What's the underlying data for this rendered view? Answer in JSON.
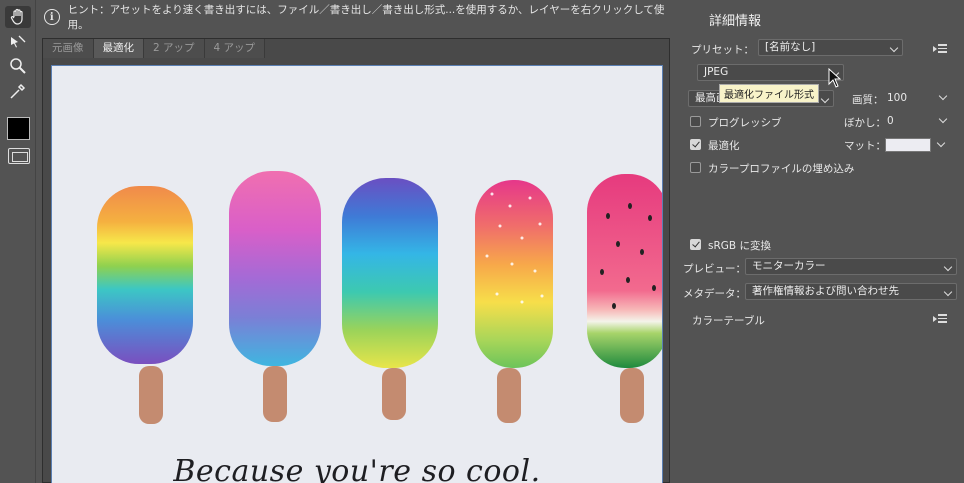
{
  "hint": {
    "text": "ヒント：アセットをより速く書き出すには、ファイル／書き出し／書き出し形式...を使用するか、レイヤーを右クリックして使用。"
  },
  "tabs": [
    {
      "label": "元画像",
      "active": false
    },
    {
      "label": "最適化",
      "active": true
    },
    {
      "label": "2 アップ",
      "active": false
    },
    {
      "label": "4 アップ",
      "active": false
    }
  ],
  "canvas": {
    "caption": "Because you're so cool."
  },
  "panel": {
    "title": "詳細情報",
    "preset_label": "プリセット：",
    "preset_value": "[名前なし]",
    "format_value": "JPEG",
    "tooltip": "最適化ファイル形式",
    "quality_level_value": "最高画質",
    "quality_label": "画質：",
    "quality_value": "100",
    "progressive_label": "プログレッシブ",
    "progressive_checked": false,
    "blur_label": "ぼかし：",
    "blur_value": "0",
    "optimized_label": "最適化",
    "optimized_checked": true,
    "matte_label": "マット：",
    "matte_color": "#ececf2",
    "embed_profile_label": "カラープロファイルの埋め込み",
    "embed_profile_checked": false,
    "srgb_label": "sRGB に変換",
    "srgb_checked": true,
    "preview_label": "プレビュー：",
    "preview_value": "モニターカラー",
    "metadata_label": "メタデータ：",
    "metadata_value": "著作権情報および問い合わせ先",
    "color_table_label": "カラーテーブル"
  },
  "icons": [
    "hand-icon",
    "slice-select-icon",
    "zoom-icon",
    "eyedropper-icon",
    "eyedropper-color-swatch",
    "screen-mode-icon",
    "info-icon",
    "panel-menu-icon",
    "mouse-cursor"
  ]
}
